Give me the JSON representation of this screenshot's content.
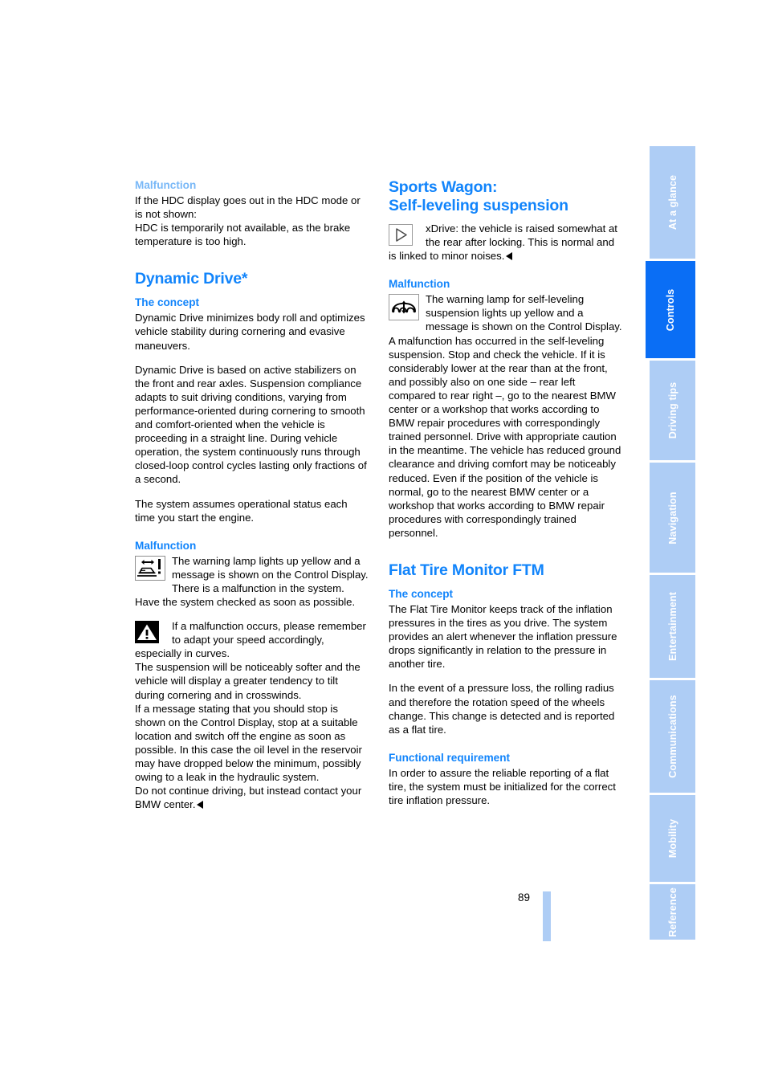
{
  "page": {
    "number": "89"
  },
  "left_column": {
    "malfunction_heading": "Malfunction",
    "hdc_paragraph": "If the HDC display goes out in the HDC mode or is not shown:",
    "hdc_paragraph2": "HDC is temporarily not available, as the brake temperature is too high.",
    "dynamic_drive_title": "Dynamic Drive*",
    "concept_heading": "The concept",
    "concept_p1": "Dynamic Drive minimizes body roll and optimizes vehicle stability during cornering and evasive maneuvers.",
    "concept_p2": "Dynamic Drive is based on active stabilizers on the front and rear axles. Suspension compliance adapts to suit driving conditions, varying from performance-oriented during cornering to smooth and comfort-oriented when the vehicle is proceeding in a straight line. During vehicle operation, the system continuously runs through closed-loop control cycles lasting only fractions of a second.",
    "concept_p3": "The system assumes operational status each time you start the engine.",
    "malfunction_heading2": "Malfunction",
    "lamp_note": "The warning lamp lights up yellow and a message is shown on the Control Display. There is a malfunction in the system. Have the system checked as soon as possible.",
    "warning_note": "If a malfunction occurs, please remember to adapt your speed accordingly, especially in curves.",
    "susp_p1": "The suspension will be noticeably softer and the vehicle will display a greater tendency to tilt during cornering and in crosswinds.",
    "susp_p2": "If a message stating that you should stop is shown on the Control Display, stop at a suitable location and switch off the engine as soon as possible. In this case the oil level in the reservoir may have dropped below the minimum, possibly owing to a leak in the hydraulic system.",
    "susp_p3": "Do not continue driving, but instead contact your BMW center."
  },
  "right_column": {
    "sports_wagon_title_line1": "Sports Wagon:",
    "sports_wagon_title_line2": "Self-leveling suspension",
    "xdrive_note": "xDrive: the vehicle is raised somewhat at the rear after locking. This is normal and is linked to minor noises.",
    "malfunction_heading": "Malfunction",
    "selfleveling_note": "The warning lamp for self-leveling suspension lights up yellow and a message is shown on the Control Display. A malfunction has occurred in the self-leveling suspension. Stop and check the vehicle. If it is considerably lower at the rear than at the front, and possibly also on one side – rear left compared to rear right –, go to the nearest BMW center or a workshop that works according to BMW repair procedures with correspondingly trained personnel. Drive with appropriate caution in the meantime. The vehicle has reduced ground clearance and driving comfort may be noticeably reduced. Even if the position of the vehicle is normal, go to the nearest BMW center or a workshop that works according to BMW repair procedures with correspondingly trained personnel.",
    "ftm_title": "Flat Tire Monitor FTM",
    "concept_heading": "The concept",
    "ftm_p1": "The Flat Tire Monitor keeps track of the inflation pressures in the tires as you drive. The system provides an alert whenever the inflation pressure drops significantly in relation to the pressure in another tire.",
    "ftm_p2": "In the event of a pressure loss, the rolling radius and therefore the rotation speed of the wheels change. This change is detected and is reported as a flat tire.",
    "functional_heading": "Functional requirement",
    "functional_p1": "In order to assure the reliable reporting of a flat tire, the system must be initialized for the correct tire inflation pressure."
  },
  "tabs": [
    {
      "label": "At a glance",
      "active": false
    },
    {
      "label": "Controls",
      "active": true
    },
    {
      "label": "Driving tips",
      "active": false
    },
    {
      "label": "Navigation",
      "active": false
    },
    {
      "label": "Entertainment",
      "active": false
    },
    {
      "label": "Communications",
      "active": false
    },
    {
      "label": "Mobility",
      "active": false
    },
    {
      "label": "Reference",
      "active": false
    }
  ],
  "colors": {
    "heading_blue": "#1184fb",
    "heading_blue_faded": "#79b8f7",
    "tab_inactive": "#aecdf5",
    "tab_active": "#0a6ef5",
    "page_bar": "#aecdf5"
  },
  "icons": {
    "note_marker": "play-triangle-icon",
    "dynamic_drive_lamp": "body-roll-warning-icon",
    "caution": "warning-triangle-icon",
    "self_leveling_lamp": "self-leveling-suspension-icon",
    "end_of_section": "end-of-section-marker"
  }
}
